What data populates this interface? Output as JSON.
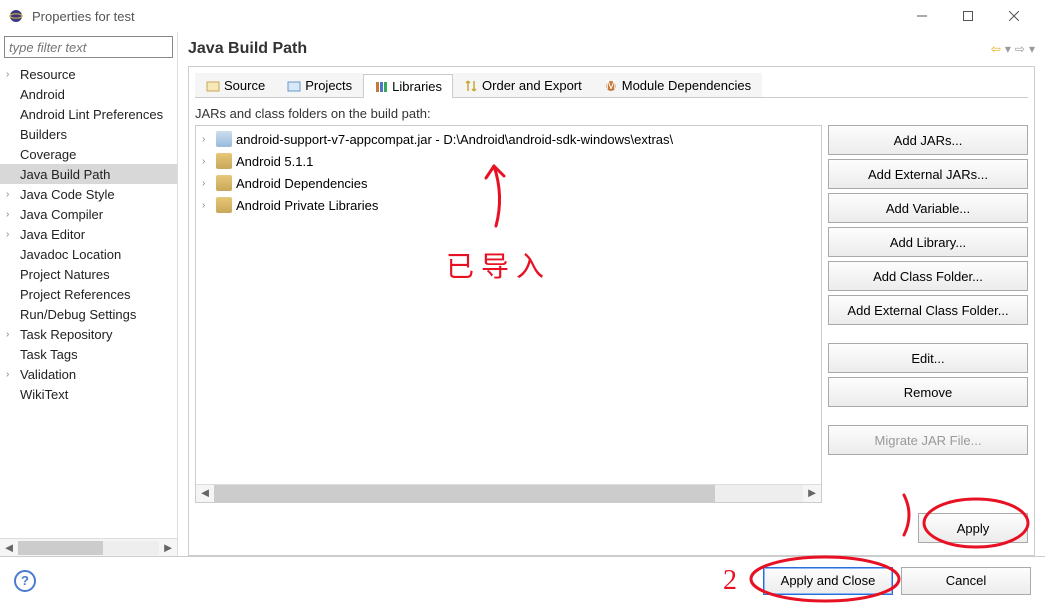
{
  "window": {
    "title": "Properties for test"
  },
  "filter": {
    "placeholder": "type filter text"
  },
  "tree": {
    "items": [
      {
        "label": "Resource",
        "expandable": true
      },
      {
        "label": "Android",
        "expandable": false
      },
      {
        "label": "Android Lint Preferences",
        "expandable": false
      },
      {
        "label": "Builders",
        "expandable": false
      },
      {
        "label": "Coverage",
        "expandable": false
      },
      {
        "label": "Java Build Path",
        "expandable": false,
        "selected": true
      },
      {
        "label": "Java Code Style",
        "expandable": true
      },
      {
        "label": "Java Compiler",
        "expandable": true
      },
      {
        "label": "Java Editor",
        "expandable": true
      },
      {
        "label": "Javadoc Location",
        "expandable": false
      },
      {
        "label": "Project Natures",
        "expandable": false
      },
      {
        "label": "Project References",
        "expandable": false
      },
      {
        "label": "Run/Debug Settings",
        "expandable": false
      },
      {
        "label": "Task Repository",
        "expandable": true
      },
      {
        "label": "Task Tags",
        "expandable": false
      },
      {
        "label": "Validation",
        "expandable": true
      },
      {
        "label": "WikiText",
        "expandable": false
      }
    ]
  },
  "heading": "Java Build Path",
  "tabs": {
    "source": "Source",
    "projects": "Projects",
    "libraries": "Libraries",
    "order": "Order and Export",
    "modules": "Module Dependencies"
  },
  "subtitle": "JARs and class folders on the build path:",
  "libs": {
    "items": [
      {
        "label": "android-support-v7-appcompat.jar - D:\\Android\\android-sdk-windows\\extras\\",
        "kind": "jar"
      },
      {
        "label": "Android 5.1.1",
        "kind": "lib"
      },
      {
        "label": "Android Dependencies",
        "kind": "lib"
      },
      {
        "label": "Android Private Libraries",
        "kind": "lib"
      }
    ]
  },
  "buttons": {
    "add_jars": "Add JARs...",
    "add_ext_jars": "Add External JARs...",
    "add_var": "Add Variable...",
    "add_lib": "Add Library...",
    "add_cf": "Add Class Folder...",
    "add_ext_cf": "Add External Class Folder...",
    "edit": "Edit...",
    "remove": "Remove",
    "migrate": "Migrate JAR File...",
    "apply": "Apply"
  },
  "bottom": {
    "apply_close": "Apply and Close",
    "cancel": "Cancel"
  },
  "annotations": {
    "text1": "已 导 入",
    "num2": "2"
  }
}
